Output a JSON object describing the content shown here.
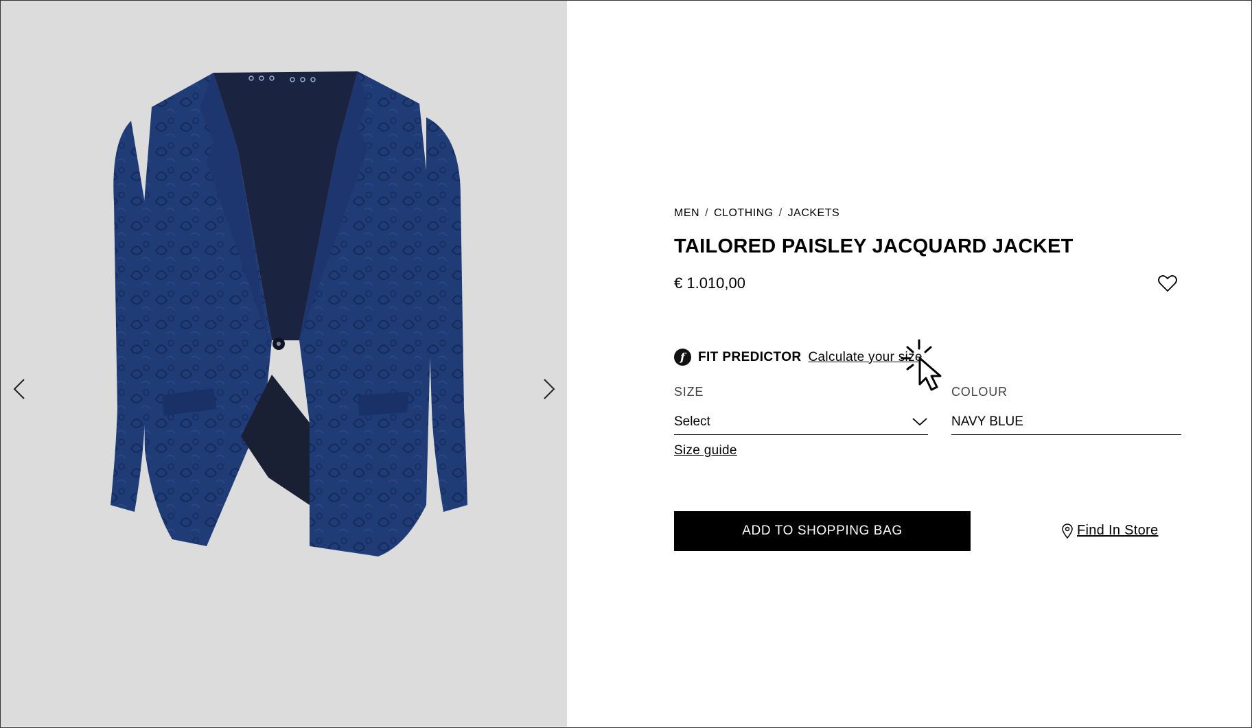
{
  "breadcrumb": [
    {
      "label": "MEN"
    },
    {
      "label": "CLOTHING"
    },
    {
      "label": "JACKETS"
    }
  ],
  "breadcrumb_separator": "/",
  "product": {
    "title": "TAILORED PAISLEY JACQUARD JACKET",
    "price": "€ 1.010,00"
  },
  "fit_predictor": {
    "logo_letter": "f",
    "label": "FIT PREDICTOR",
    "link": "Calculate your size"
  },
  "size": {
    "label": "SIZE",
    "selected": "Select"
  },
  "colour": {
    "label": "COLOUR",
    "value": "NAVY BLUE"
  },
  "size_guide": "Size guide",
  "actions": {
    "add_to_bag": "ADD TO SHOPPING BAG",
    "find_in_store": "Find In Store"
  },
  "icons": {
    "prev": "chevron-left-icon",
    "next": "chevron-right-icon",
    "wishlist": "heart-icon",
    "dropdown": "chevron-down-icon",
    "location": "location-pin-icon",
    "cursor": "click-cursor-icon"
  },
  "colors": {
    "gallery_bg": "#dcdcdc",
    "jacket": "#1f3a73",
    "button_bg": "#000000",
    "button_text": "#ffffff"
  }
}
